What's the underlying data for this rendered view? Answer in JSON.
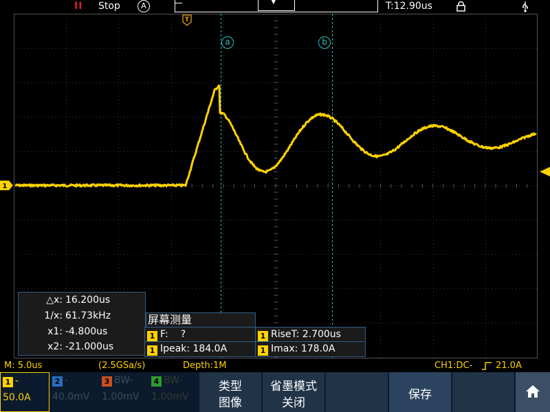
{
  "top_bar": {
    "run_state": "Stop",
    "run_icon": "pause-icon",
    "run_glyph": "II",
    "mode_icon": "auto-trigger-icon",
    "mode_letter": "A",
    "time_offset": "T:12.90us",
    "lock_icon": "lock-icon",
    "usb_icon": "usb-icon"
  },
  "markers": {
    "trigger_marker": "T",
    "channel_marker": "1",
    "cursor_a": "a",
    "cursor_b": "b"
  },
  "cursor_readout": {
    "delta_x_label": "△x:",
    "delta_x": "16.200us",
    "inv_x_label": "1/x:",
    "inv_x": "61.73kHz",
    "x1_label": "x1:",
    "x1": "-4.800us",
    "x2_label": "x2:",
    "x2": "-21.000us"
  },
  "measurements": {
    "title": "屏幕测量",
    "items": [
      {
        "channel": "1",
        "label": "F:",
        "value": "?"
      },
      {
        "channel": "1",
        "label": "RiseT:",
        "value": "2.700us"
      },
      {
        "channel": "1",
        "label": "Ipeak:",
        "value": "184.0A"
      },
      {
        "channel": "1",
        "label": "Imax:",
        "value": "178.0A"
      }
    ]
  },
  "status_line": {
    "timebase": "M: 5.0us",
    "sample_rate": "(2.5GSa/s)",
    "depth": "Depth:1M",
    "trigger_info": "CH1:DC-",
    "trigger_level": "21.0A"
  },
  "channels": [
    {
      "num": "1",
      "coupling": "-",
      "scale": "50.0A",
      "color": "#ffd200"
    },
    {
      "num": "2",
      "coupling": "-",
      "scale": "40.0mV",
      "color": "#2a6cc0"
    },
    {
      "num": "3",
      "coupling": "BW-",
      "scale": "1.00mV",
      "color": "#c8501e"
    },
    {
      "num": "4",
      "coupling": "BW-",
      "scale": "1.00mV",
      "color": "#2e9a2e"
    }
  ],
  "menu": {
    "type_label": "类型",
    "type_value": "图像",
    "ink_label": "省墨模式",
    "ink_value": "关闭",
    "save_label": "保存",
    "home_icon": "home-icon"
  },
  "colors": {
    "trace": "#ffd200",
    "cursor": "#29c4c4",
    "grid": "#3a3a3a",
    "panel_border": "#2e5f8a"
  }
}
